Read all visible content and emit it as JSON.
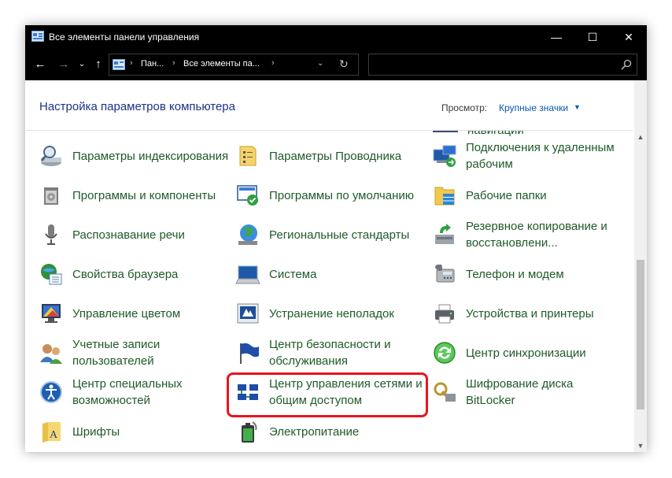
{
  "window": {
    "title": "Все элементы панели управления",
    "buttons": {
      "minimize": "—",
      "maximize": "☐",
      "close": "✕"
    }
  },
  "nav": {
    "back": "←",
    "forward": "→",
    "recent": "⌄",
    "up": "↑",
    "breadcrumbs": [
      "Пан...",
      "Все элементы па..."
    ],
    "separator": "›",
    "dropdown": "⌄",
    "refresh": "↻",
    "search_placeholder": ""
  },
  "content": {
    "heading": "Настройка параметров компьютера",
    "view_label": "Просмотр:",
    "view_value": "Крупные значки",
    "partial_item": "навигации"
  },
  "items": [
    {
      "label": "Параметры индексирования",
      "icon": "indexing-icon"
    },
    {
      "label": "Параметры Проводника",
      "icon": "explorer-options-icon"
    },
    {
      "label": "Подключения к удаленным рабочим",
      "icon": "remote-desktop-icon"
    },
    {
      "label": "Программы и компоненты",
      "icon": "programs-icon"
    },
    {
      "label": "Программы по умолчанию",
      "icon": "default-programs-icon"
    },
    {
      "label": "Рабочие папки",
      "icon": "work-folders-icon"
    },
    {
      "label": "Распознавание речи",
      "icon": "microphone-icon"
    },
    {
      "label": "Региональные стандарты",
      "icon": "region-icon"
    },
    {
      "label": "Резервное копирование и восстановлени...",
      "icon": "backup-icon"
    },
    {
      "label": "Свойства браузера",
      "icon": "internet-options-icon"
    },
    {
      "label": "Система",
      "icon": "system-icon"
    },
    {
      "label": "Телефон и модем",
      "icon": "phone-modem-icon"
    },
    {
      "label": "Управление цветом",
      "icon": "color-management-icon"
    },
    {
      "label": "Устранение неполадок",
      "icon": "troubleshooting-icon"
    },
    {
      "label": "Устройства и принтеры",
      "icon": "printer-icon"
    },
    {
      "label": "Учетные записи пользователей",
      "icon": "user-accounts-icon"
    },
    {
      "label": "Центр безопасности и обслуживания",
      "icon": "security-flag-icon"
    },
    {
      "label": "Центр синхронизации",
      "icon": "sync-center-icon"
    },
    {
      "label": "Центр специальных возможностей",
      "icon": "accessibility-icon"
    },
    {
      "label": "Центр управления сетями и общим доступом",
      "icon": "network-center-icon"
    },
    {
      "label": "Шифрование диска BitLocker",
      "icon": "bitlocker-icon"
    },
    {
      "label": "Шрифты",
      "icon": "fonts-icon"
    },
    {
      "label": "Электропитание",
      "icon": "power-options-icon"
    }
  ],
  "colors": {
    "link": "#1f5a28",
    "heading": "#1e3287",
    "accent": "#0a56b0",
    "highlight": "#e8141e"
  }
}
